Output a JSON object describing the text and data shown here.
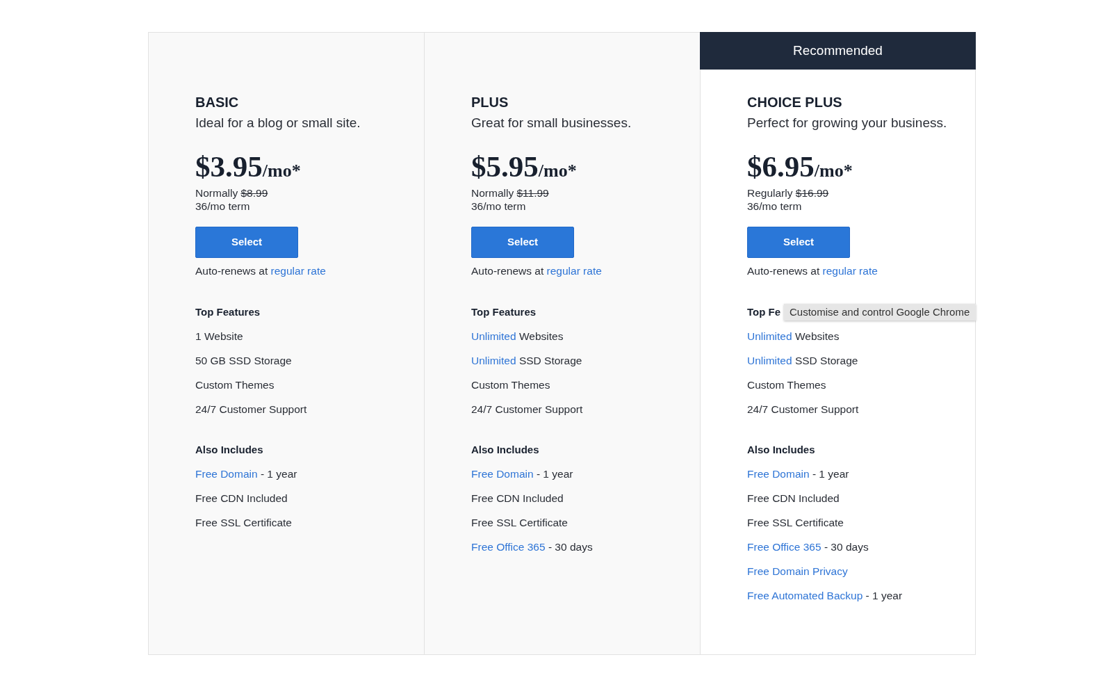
{
  "plans": [
    {
      "name": "BASIC",
      "tagline": "Ideal for a blog or small site.",
      "price": "$3.95",
      "period": "/mo*",
      "regular_label": "Normally",
      "regular_price": "$8.99",
      "term": "36/mo term",
      "button": "Select",
      "renewal_text": "Auto-renews at",
      "renewal_link": "regular rate",
      "sections": [
        {
          "title": "Top Features",
          "items": [
            {
              "text": "1 Website"
            },
            {
              "text": "50 GB SSD Storage"
            },
            {
              "text": "Custom Themes"
            },
            {
              "text": "24/7 Customer Support"
            }
          ]
        },
        {
          "title": "Also Includes",
          "items": [
            {
              "link": "Free Domain",
              "text": "- 1 year"
            },
            {
              "text": "Free CDN Included"
            },
            {
              "text": "Free SSL Certificate"
            }
          ]
        }
      ]
    },
    {
      "name": "PLUS",
      "tagline": "Great for small businesses.",
      "price": "$5.95",
      "period": "/mo*",
      "regular_label": "Normally",
      "regular_price": "$11.99",
      "term": "36/mo term",
      "button": "Select",
      "renewal_text": "Auto-renews at",
      "renewal_link": "regular rate",
      "sections": [
        {
          "title": "Top Features",
          "items": [
            {
              "link": "Unlimited",
              "text": "Websites"
            },
            {
              "link": "Unlimited",
              "text": "SSD Storage"
            },
            {
              "text": "Custom Themes"
            },
            {
              "text": "24/7 Customer Support"
            }
          ]
        },
        {
          "title": "Also Includes",
          "items": [
            {
              "link": "Free Domain",
              "text": "- 1 year"
            },
            {
              "text": "Free CDN Included"
            },
            {
              "text": "Free SSL Certificate"
            },
            {
              "link": "Free Office 365",
              "text": "- 30 days"
            }
          ]
        }
      ]
    },
    {
      "banner": "Recommended",
      "name": "CHOICE PLUS",
      "tagline": "Perfect for growing your business.",
      "price": "$6.95",
      "period": "/mo*",
      "regular_label": "Regularly",
      "regular_price": "$16.99",
      "term": "36/mo term",
      "button": "Select",
      "renewal_text": "Auto-renews at",
      "renewal_link": "regular rate",
      "sections": [
        {
          "title": "Top Fe",
          "items": [
            {
              "link": "Unlimited",
              "text": "Websites"
            },
            {
              "link": "Unlimited",
              "text": "SSD Storage"
            },
            {
              "text": "Custom Themes"
            },
            {
              "text": "24/7 Customer Support"
            }
          ]
        },
        {
          "title": "Also Includes",
          "items": [
            {
              "link": "Free Domain",
              "text": "- 1 year"
            },
            {
              "text": "Free CDN Included"
            },
            {
              "text": "Free SSL Certificate"
            },
            {
              "link": "Free Office 365",
              "text": "- 30 days"
            },
            {
              "link": "Free Domain Privacy"
            },
            {
              "link": "Free Automated Backup",
              "text": "- 1 year"
            }
          ]
        }
      ]
    }
  ],
  "tooltip": {
    "text": "Customise and control Google Chrome"
  }
}
